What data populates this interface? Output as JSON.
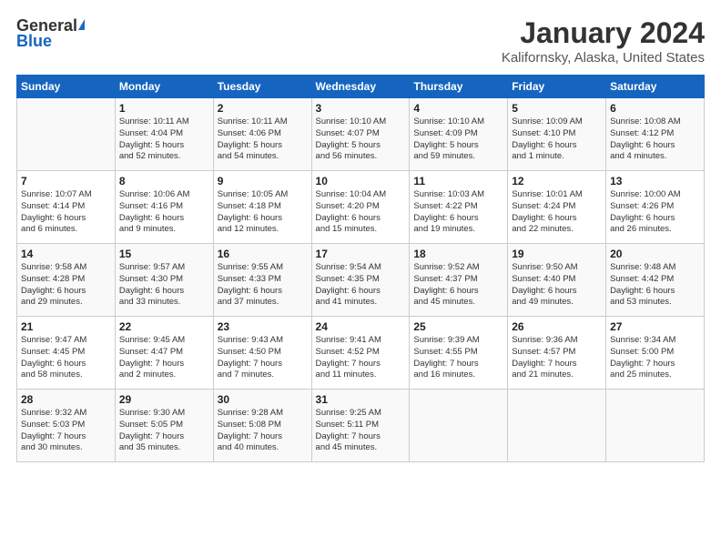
{
  "logo": {
    "general": "General",
    "blue": "Blue"
  },
  "title": "January 2024",
  "subtitle": "Kalifornsky, Alaska, United States",
  "headers": [
    "Sunday",
    "Monday",
    "Tuesday",
    "Wednesday",
    "Thursday",
    "Friday",
    "Saturday"
  ],
  "weeks": [
    [
      {
        "day": "",
        "info": ""
      },
      {
        "day": "1",
        "info": "Sunrise: 10:11 AM\nSunset: 4:04 PM\nDaylight: 5 hours\nand 52 minutes."
      },
      {
        "day": "2",
        "info": "Sunrise: 10:11 AM\nSunset: 4:06 PM\nDaylight: 5 hours\nand 54 minutes."
      },
      {
        "day": "3",
        "info": "Sunrise: 10:10 AM\nSunset: 4:07 PM\nDaylight: 5 hours\nand 56 minutes."
      },
      {
        "day": "4",
        "info": "Sunrise: 10:10 AM\nSunset: 4:09 PM\nDaylight: 5 hours\nand 59 minutes."
      },
      {
        "day": "5",
        "info": "Sunrise: 10:09 AM\nSunset: 4:10 PM\nDaylight: 6 hours\nand 1 minute."
      },
      {
        "day": "6",
        "info": "Sunrise: 10:08 AM\nSunset: 4:12 PM\nDaylight: 6 hours\nand 4 minutes."
      }
    ],
    [
      {
        "day": "7",
        "info": "Sunrise: 10:07 AM\nSunset: 4:14 PM\nDaylight: 6 hours\nand 6 minutes."
      },
      {
        "day": "8",
        "info": "Sunrise: 10:06 AM\nSunset: 4:16 PM\nDaylight: 6 hours\nand 9 minutes."
      },
      {
        "day": "9",
        "info": "Sunrise: 10:05 AM\nSunset: 4:18 PM\nDaylight: 6 hours\nand 12 minutes."
      },
      {
        "day": "10",
        "info": "Sunrise: 10:04 AM\nSunset: 4:20 PM\nDaylight: 6 hours\nand 15 minutes."
      },
      {
        "day": "11",
        "info": "Sunrise: 10:03 AM\nSunset: 4:22 PM\nDaylight: 6 hours\nand 19 minutes."
      },
      {
        "day": "12",
        "info": "Sunrise: 10:01 AM\nSunset: 4:24 PM\nDaylight: 6 hours\nand 22 minutes."
      },
      {
        "day": "13",
        "info": "Sunrise: 10:00 AM\nSunset: 4:26 PM\nDaylight: 6 hours\nand 26 minutes."
      }
    ],
    [
      {
        "day": "14",
        "info": "Sunrise: 9:58 AM\nSunset: 4:28 PM\nDaylight: 6 hours\nand 29 minutes."
      },
      {
        "day": "15",
        "info": "Sunrise: 9:57 AM\nSunset: 4:30 PM\nDaylight: 6 hours\nand 33 minutes."
      },
      {
        "day": "16",
        "info": "Sunrise: 9:55 AM\nSunset: 4:33 PM\nDaylight: 6 hours\nand 37 minutes."
      },
      {
        "day": "17",
        "info": "Sunrise: 9:54 AM\nSunset: 4:35 PM\nDaylight: 6 hours\nand 41 minutes."
      },
      {
        "day": "18",
        "info": "Sunrise: 9:52 AM\nSunset: 4:37 PM\nDaylight: 6 hours\nand 45 minutes."
      },
      {
        "day": "19",
        "info": "Sunrise: 9:50 AM\nSunset: 4:40 PM\nDaylight: 6 hours\nand 49 minutes."
      },
      {
        "day": "20",
        "info": "Sunrise: 9:48 AM\nSunset: 4:42 PM\nDaylight: 6 hours\nand 53 minutes."
      }
    ],
    [
      {
        "day": "21",
        "info": "Sunrise: 9:47 AM\nSunset: 4:45 PM\nDaylight: 6 hours\nand 58 minutes."
      },
      {
        "day": "22",
        "info": "Sunrise: 9:45 AM\nSunset: 4:47 PM\nDaylight: 7 hours\nand 2 minutes."
      },
      {
        "day": "23",
        "info": "Sunrise: 9:43 AM\nSunset: 4:50 PM\nDaylight: 7 hours\nand 7 minutes."
      },
      {
        "day": "24",
        "info": "Sunrise: 9:41 AM\nSunset: 4:52 PM\nDaylight: 7 hours\nand 11 minutes."
      },
      {
        "day": "25",
        "info": "Sunrise: 9:39 AM\nSunset: 4:55 PM\nDaylight: 7 hours\nand 16 minutes."
      },
      {
        "day": "26",
        "info": "Sunrise: 9:36 AM\nSunset: 4:57 PM\nDaylight: 7 hours\nand 21 minutes."
      },
      {
        "day": "27",
        "info": "Sunrise: 9:34 AM\nSunset: 5:00 PM\nDaylight: 7 hours\nand 25 minutes."
      }
    ],
    [
      {
        "day": "28",
        "info": "Sunrise: 9:32 AM\nSunset: 5:03 PM\nDaylight: 7 hours\nand 30 minutes."
      },
      {
        "day": "29",
        "info": "Sunrise: 9:30 AM\nSunset: 5:05 PM\nDaylight: 7 hours\nand 35 minutes."
      },
      {
        "day": "30",
        "info": "Sunrise: 9:28 AM\nSunset: 5:08 PM\nDaylight: 7 hours\nand 40 minutes."
      },
      {
        "day": "31",
        "info": "Sunrise: 9:25 AM\nSunset: 5:11 PM\nDaylight: 7 hours\nand 45 minutes."
      },
      {
        "day": "",
        "info": ""
      },
      {
        "day": "",
        "info": ""
      },
      {
        "day": "",
        "info": ""
      }
    ]
  ]
}
